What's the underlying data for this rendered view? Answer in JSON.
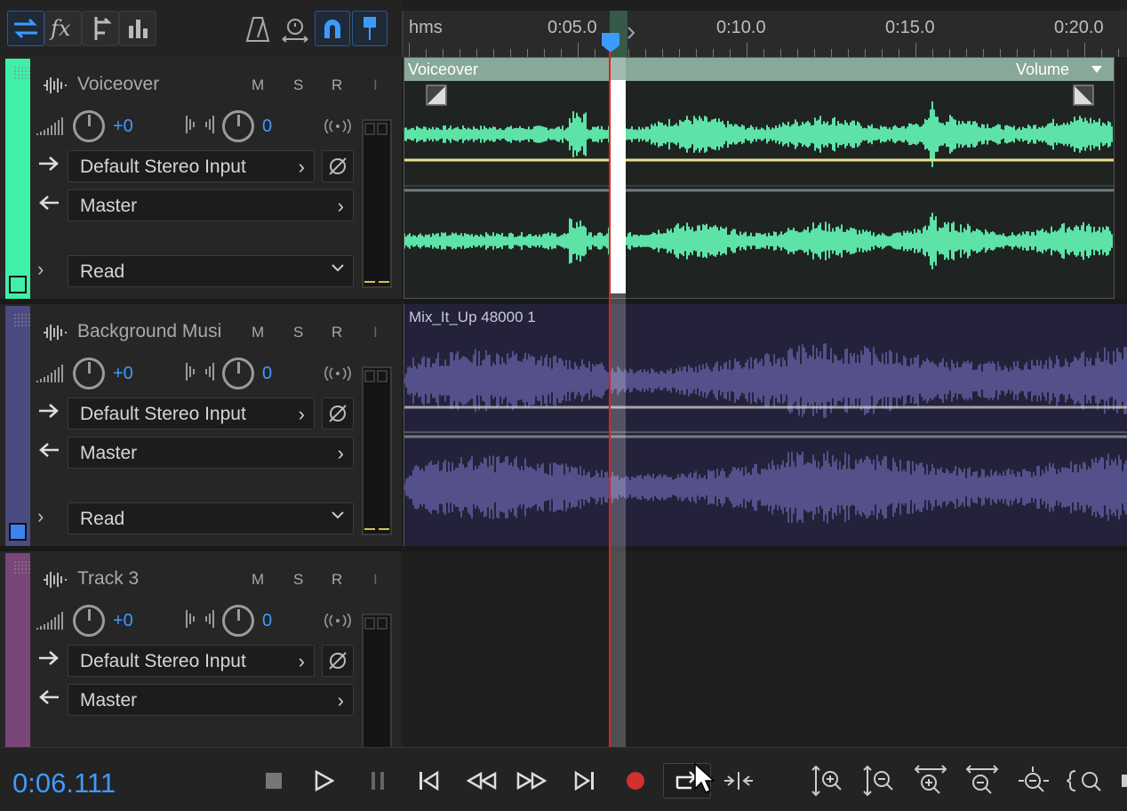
{
  "ruler": {
    "unit_label": "hms",
    "marks": [
      "0:05.0",
      "0:10.0",
      "0:15.0",
      "0:20.0"
    ]
  },
  "tracks": [
    {
      "name": "Voiceover",
      "color": "#3ff0a8",
      "m": "M",
      "s": "S",
      "r": "R",
      "i": "I",
      "volume": "+0",
      "pan": "0",
      "input": "Default Stereo Input",
      "output": "Master",
      "automation": "Read"
    },
    {
      "name": "Background Musi",
      "color": "#4b4b82",
      "m": "M",
      "s": "S",
      "r": "R",
      "i": "I",
      "volume": "+0",
      "pan": "0",
      "input": "Default Stereo Input",
      "output": "Master",
      "automation": "Read"
    },
    {
      "name": "Track 3",
      "color": "#7a4578",
      "m": "M",
      "s": "S",
      "r": "R",
      "i": "I",
      "volume": "+0",
      "pan": "0",
      "input": "Default Stereo Input",
      "output": "Master"
    }
  ],
  "clips": {
    "voiceover": {
      "name": "Voiceover",
      "envelope_menu": "Volume",
      "color": "#5de2a8"
    },
    "music": {
      "name": "Mix_It_Up 48000 1",
      "color": "#53508a"
    }
  },
  "transport": {
    "time": "0:06.111"
  },
  "colors": {
    "accent_blue": "#3d9bff",
    "playhead": "#e02020",
    "record": "#d0302f"
  },
  "icons": {
    "toolbar": [
      "switch-editor-icon",
      "fx-icon",
      "sends-icon",
      "eq-icon",
      "metronome-icon",
      "time-stretch-icon",
      "snap-icon",
      "marker-icon"
    ],
    "transport": [
      "stop-icon",
      "play-icon",
      "pause-icon",
      "go-to-start-icon",
      "rewind-icon",
      "fast-forward-icon",
      "go-to-end-icon",
      "record-icon",
      "loop-icon",
      "skip-selection-icon",
      "zoom-in-amplitude-icon",
      "zoom-out-amplitude-icon",
      "zoom-in-time-icon",
      "zoom-out-time-icon",
      "zoom-out-full-icon",
      "zoom-selection-icon"
    ]
  }
}
